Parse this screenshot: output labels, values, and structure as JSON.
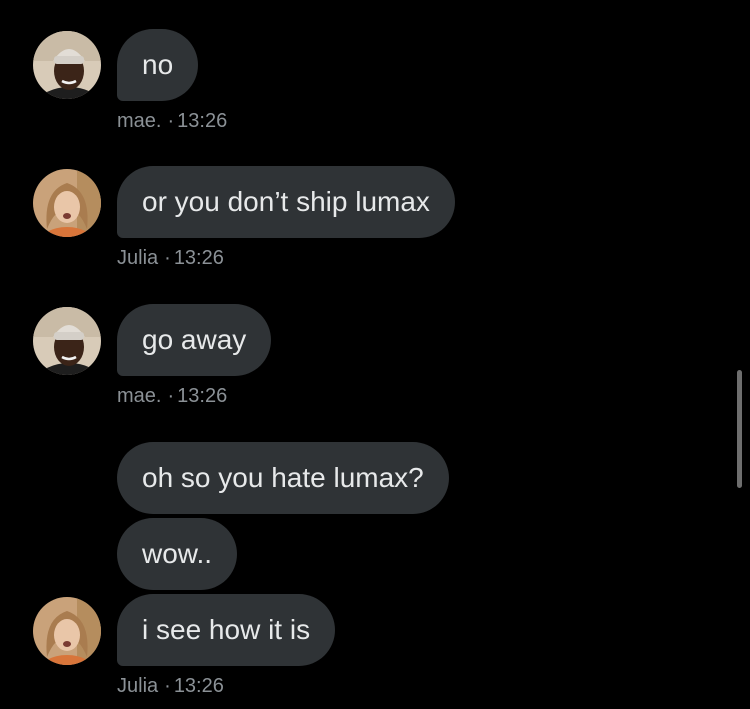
{
  "conversation": {
    "messages": [
      {
        "text": "no"
      },
      {
        "text": "or you don’t ship lumax"
      },
      {
        "text": "go away"
      },
      {
        "text": "oh so you hate lumax?"
      },
      {
        "text": "wow.."
      },
      {
        "text": "i see how it is"
      }
    ],
    "groups": [
      {
        "sender": "mae.",
        "separator": "·",
        "time": "13:26"
      },
      {
        "sender": "Julia",
        "separator": "·",
        "time": "13:26"
      },
      {
        "sender": "mae.",
        "separator": "·",
        "time": "13:26"
      },
      {
        "sender": "Julia",
        "separator": "·",
        "time": "13:26"
      }
    ]
  },
  "avatars": {
    "mae": {
      "icon": "avatar-mae",
      "skin": "#3b2418",
      "hat": "#e2ddd6",
      "bg": "#d8cbb8"
    },
    "julia": {
      "icon": "avatar-julia",
      "hair": "#a97c4f",
      "skin": "#e9c6a8",
      "bg": "#c9a27a"
    }
  },
  "colors": {
    "background": "#000000",
    "bubble": "#2f3336",
    "text": "#e7e9ea",
    "meta": "#8b9196"
  }
}
